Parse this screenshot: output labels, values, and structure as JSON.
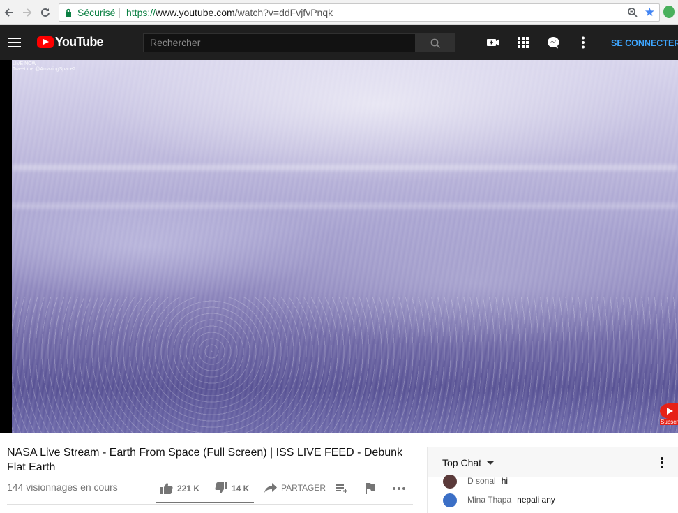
{
  "browser": {
    "secure_label": "Sécurisé",
    "url_prefix": "https://",
    "url_host": "www.youtube.com",
    "url_path": "/watch?v=ddFvjfvPnqk"
  },
  "masthead": {
    "brand": "YouTube",
    "search_placeholder": "Rechercher",
    "signin_label": "SE CONNECTER"
  },
  "player": {
    "overlay_line1": "LIVE NOW",
    "overlay_line2": "Tweet me @AmazingSpace2",
    "subscribe_badge": "Subscribe"
  },
  "video": {
    "title": "NASA Live Stream - Earth From Space (Full Screen) | ISS LIVE FEED - Debunk Flat Earth",
    "views": "144 visionnages en cours",
    "likes": "221 K",
    "dislikes": "14 K",
    "share_label": "PARTAGER",
    "like_ratio": 0.94
  },
  "chat": {
    "title": "Top Chat",
    "messages": [
      {
        "author": "D sonal",
        "text": "hi",
        "avatar_color": "#5a3a3a"
      },
      {
        "author": "Mina Thapa",
        "text": "nepali any",
        "avatar_color": "#3b6fc6"
      }
    ]
  },
  "icons": {
    "back": "arrow-left-icon",
    "forward": "arrow-right-icon",
    "reload": "reload-icon",
    "lock": "lock-icon",
    "zoom": "zoom-icon",
    "star": "star-icon",
    "create": "video-camera-plus-icon",
    "apps": "apps-grid-icon",
    "messages": "chat-bubble-icon",
    "more": "kebab-icon",
    "like": "thumbs-up-icon",
    "dislike": "thumbs-down-icon",
    "share": "share-arrow-icon",
    "add_playlist": "playlist-add-icon",
    "flag": "flag-icon"
  },
  "colors": {
    "brand_red": "#ff0000",
    "masthead_bg": "#1f1f1f",
    "link_blue": "#3ea6ff",
    "secure_green": "#0b8043"
  }
}
